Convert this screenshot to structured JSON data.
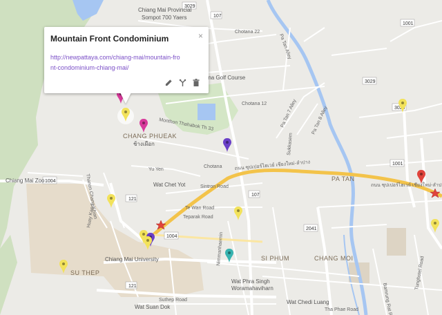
{
  "popup": {
    "title": "Mountain Front Condominium",
    "link": "http://newpattaya.com/chiang-mai/mountain-front-condominium-chiang-mai/",
    "close": "×",
    "tools": [
      "pencil-icon",
      "route-icon",
      "trash-icon"
    ]
  },
  "places": {
    "provincial_top": "Chiang Mai Provincial",
    "provincial_sub": "Sompot 700 Yaers",
    "lanna_golf": "Lanna Golf Course",
    "chang_phueak": "CHANG PHUEAK",
    "chang_phueak_th": "ช้างเผือก",
    "zoo": "Chiang Mai Zoo",
    "wat_chet_yot": "Wat Chet Yot",
    "university": "Chiang Mai University",
    "su_thep": "SU THEP",
    "si_phum": "SI PHUM",
    "chang_moi": "CHANG MOI",
    "wat_phra_singh_1": "Wat Phra Singh",
    "wat_phra_singh_2": "Woramahaviharn",
    "wat_chedi_luang": "Wat Chedi Luang",
    "wat_suan_dok": "Wat Suan Dok",
    "pa_tan": "PA TAN"
  },
  "roads": {
    "chotana_22": "Chotana 22",
    "chotana_12": "Chotana 12",
    "chotana": "Chotana",
    "monthon": "Monthon Thahabok Th 33",
    "yu_yen": "Yu Yen",
    "sintron": "Sintron Road",
    "te_wan": "Te Wan Road",
    "teparak": "Teparak Road",
    "suthep": "Suthep Road",
    "tha_phae": "Tha Phae Road",
    "superhighway": "ถนน ซุปเปอร์ไฮเวย์ เชียงใหม่-ลำปาง",
    "pa_tan_alley": "Pa Tan Alley",
    "pa_tan_7_alley": "Pa Tan 7 Alley",
    "pa_tan_8_alley": "Pa Tan 8 Alley",
    "sukkasem": "Sukkasem",
    "bamrung_rat": "Bamrung Rat Road",
    "tung_hotel": "Tunghotel Road",
    "nimmanhaemin": "Nimmanhaemin",
    "huay_kaew": "Huay Kaeo",
    "thanon_chang_khian": "Thanon Chang Khian",
    "rt_1004_a": "1004",
    "rt_1004_b": "1004",
    "rt_121_a": "121",
    "rt_121_b": "121",
    "rt_107_a": "107",
    "rt_107_b": "107",
    "rt_3029_a": "3029",
    "rt_3029_b": "3029",
    "rt_3029_c": "3029",
    "rt_1001_a": "1001",
    "rt_1001_b": "1001",
    "rt_2041": "2041"
  }
}
